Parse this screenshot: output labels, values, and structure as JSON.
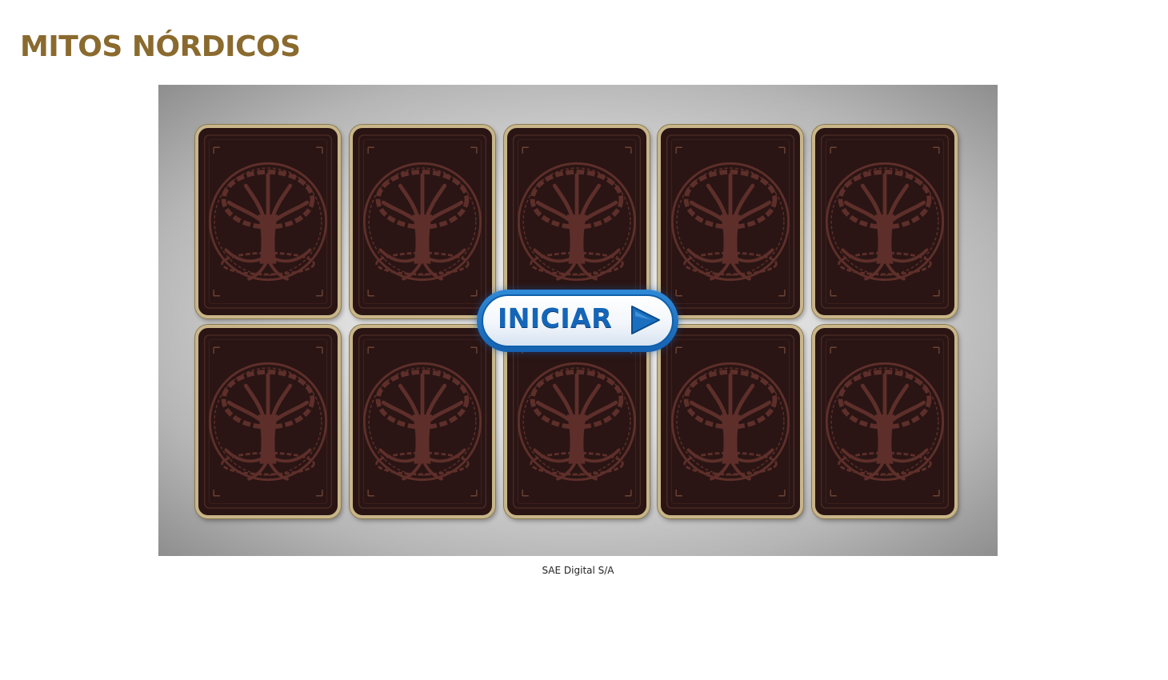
{
  "header": {
    "title": "MITOS NÓRDICOS"
  },
  "game": {
    "start_button_label": "INICIAR",
    "start_button_icon": "play-icon",
    "card_back_icon": "tree-of-life-icon",
    "card_rows": 2,
    "card_columns": 5,
    "card_count": 10,
    "colors": {
      "title": "#8a6a2e",
      "card_back": "#2a1514",
      "card_border": "#c8b68a",
      "button_blue": "#1566b8"
    }
  },
  "footer": {
    "credit": "SAE Digital S/A"
  }
}
